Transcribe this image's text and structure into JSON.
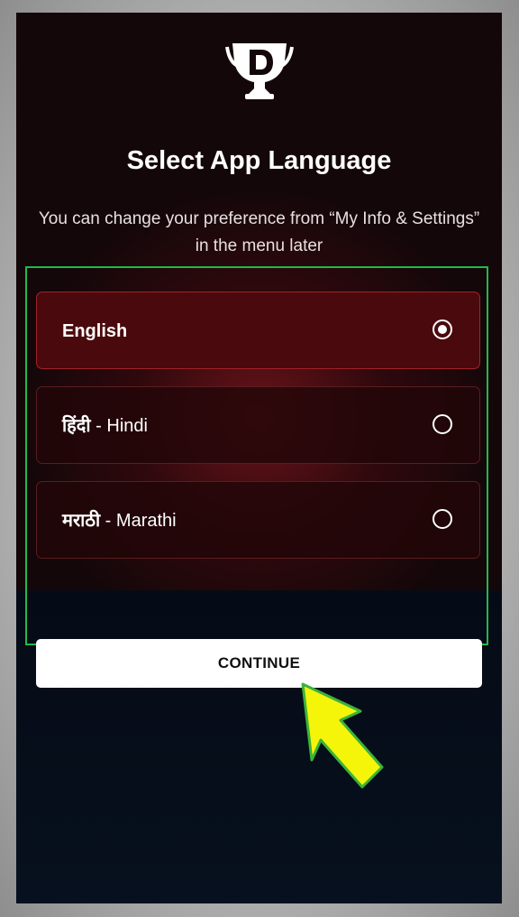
{
  "header": {
    "logo_icon": "dream11-trophy-logo",
    "title": "Select App Language",
    "subtitle": "You can change your preference from “My Info & Settings” in the menu later"
  },
  "languages": [
    {
      "native": "",
      "name": "English",
      "selected": true
    },
    {
      "native": "हिंदी",
      "separator": " - ",
      "name": "Hindi",
      "selected": false
    },
    {
      "native": "मराठी",
      "separator": " - ",
      "name": "Marathi",
      "selected": false
    }
  ],
  "actions": {
    "continue_label": "CONTINUE"
  },
  "annotation": {
    "arrow_icon": "pointer-arrow-icon",
    "arrow_color": "#f5f50a",
    "highlight_color": "#21b94a"
  },
  "colors": {
    "selected_bg": "#4a0a0d",
    "background": "#120608",
    "bottom_bg": "#06101e"
  }
}
